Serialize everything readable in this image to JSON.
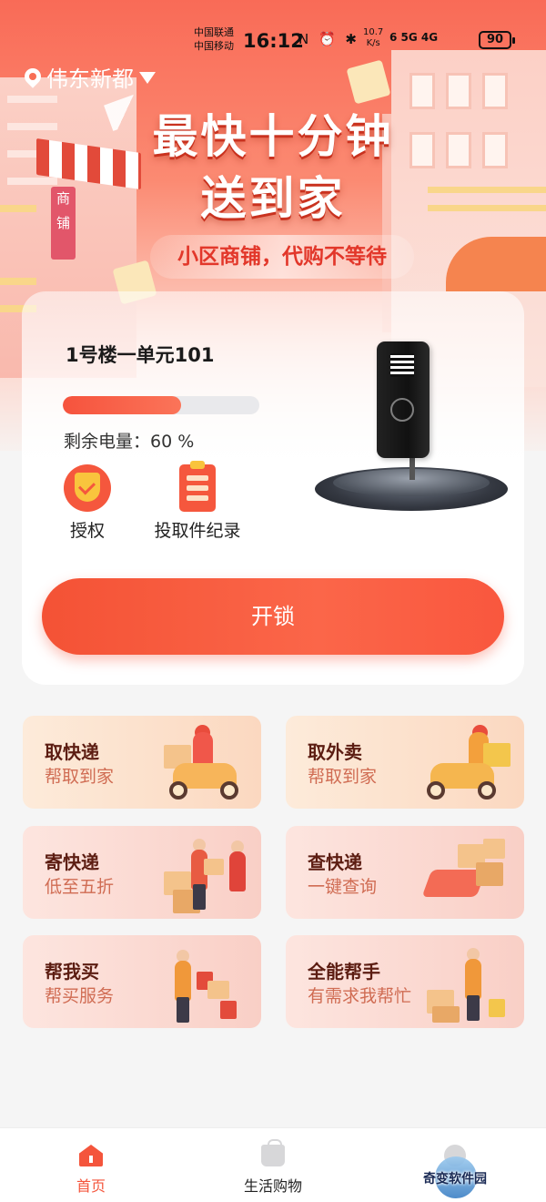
{
  "status_bar": {
    "carrier_1": "中国联通",
    "carrier_2": "中国移动",
    "time": "16:12",
    "icons": "N ⏰ ✱",
    "speed_value": "10.7",
    "speed_unit": "K/s",
    "network": "6 5G 4G",
    "battery": "90"
  },
  "location": {
    "name": "伟东新都"
  },
  "banner": {
    "title_line1": "最快十分钟",
    "title_line2": "送到家",
    "subtitle": "小区商铺，代购不等待",
    "shop_sign": "商铺"
  },
  "device_card": {
    "room": "1号楼一单元101",
    "battery_percent": 60,
    "battery_label": "剩余电量：60 %",
    "authorize_label": "授权",
    "records_label": "投取件纪录",
    "unlock_label": "开锁"
  },
  "services": [
    {
      "title": "取快递",
      "subtitle": "帮取到家"
    },
    {
      "title": "取外卖",
      "subtitle": "帮取到家"
    },
    {
      "title": "寄快递",
      "subtitle": "低至五折"
    },
    {
      "title": "查快递",
      "subtitle": "一键查询"
    },
    {
      "title": "帮我买",
      "subtitle": "帮买服务"
    },
    {
      "title": "全能帮手",
      "subtitle": "有需求我帮忙"
    }
  ],
  "bottom_nav": {
    "home": "首页",
    "shopping": "生活购物",
    "watermark": "奇变软件园"
  },
  "colors": {
    "accent": "#f4553c",
    "service_title": "#5c1d12",
    "service_sub": "#d06c53"
  }
}
